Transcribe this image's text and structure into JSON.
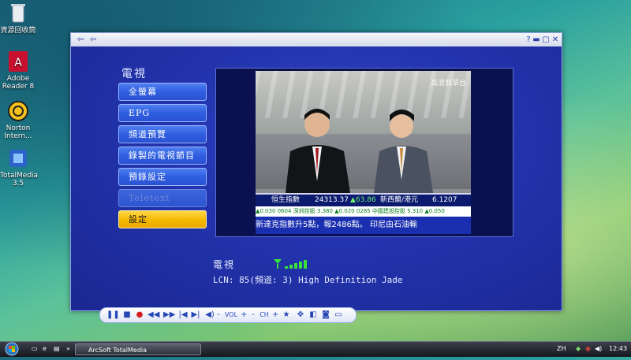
{
  "desktop": {
    "icons": [
      {
        "label": "資源回收筒",
        "icon": "recycle-bin-icon"
      },
      {
        "label": "Adobe Reader 8",
        "icon": "adobe-reader-icon"
      },
      {
        "label": "Norton Intern...",
        "icon": "norton-icon"
      },
      {
        "label": "TotalMedia 3.5",
        "icon": "totalmedia-icon"
      }
    ]
  },
  "window": {
    "section_title": "電視",
    "menu": [
      {
        "label": "全螢幕",
        "state": "normal"
      },
      {
        "label": "EPG",
        "state": "normal"
      },
      {
        "label": "頻道預覽",
        "state": "normal"
      },
      {
        "label": "錄製的電視節目",
        "state": "normal"
      },
      {
        "label": "預錄設定",
        "state": "normal"
      },
      {
        "label": "Teletext",
        "state": "disabled"
      },
      {
        "label": "設定",
        "state": "selected"
      }
    ],
    "video": {
      "channel_logo": "高清翡翠台",
      "ticker_index_label": "恒生指數",
      "ticker_index_value": "24313.37",
      "ticker_index_change": "▲63.86",
      "ticker_fx_label": "新西蘭/港元",
      "ticker_fx_value": "6.1207",
      "ticker_stocks": "▲0.030  0604 深圳控股 3.380 ▲0.020  0285 中國建設控股 5.310 ▲0.050",
      "ticker_news": "新達克指數升5點，報2486點。     印尼由石油輸"
    },
    "info_title": "電視",
    "signal_bars": 5,
    "info_line": "LCN: 85(頻道: 3) High Definition Jade",
    "controls": {
      "vol_label": "VOL",
      "ch_label": "CH"
    }
  },
  "taskbar": {
    "task_label": "ArcSoft TotalMedia",
    "lang": "ZH",
    "clock": "12:43"
  },
  "colors": {
    "window_bg": "#2233ad",
    "menu_normal": "#2f5fe0",
    "menu_selected": "#f5b700"
  }
}
